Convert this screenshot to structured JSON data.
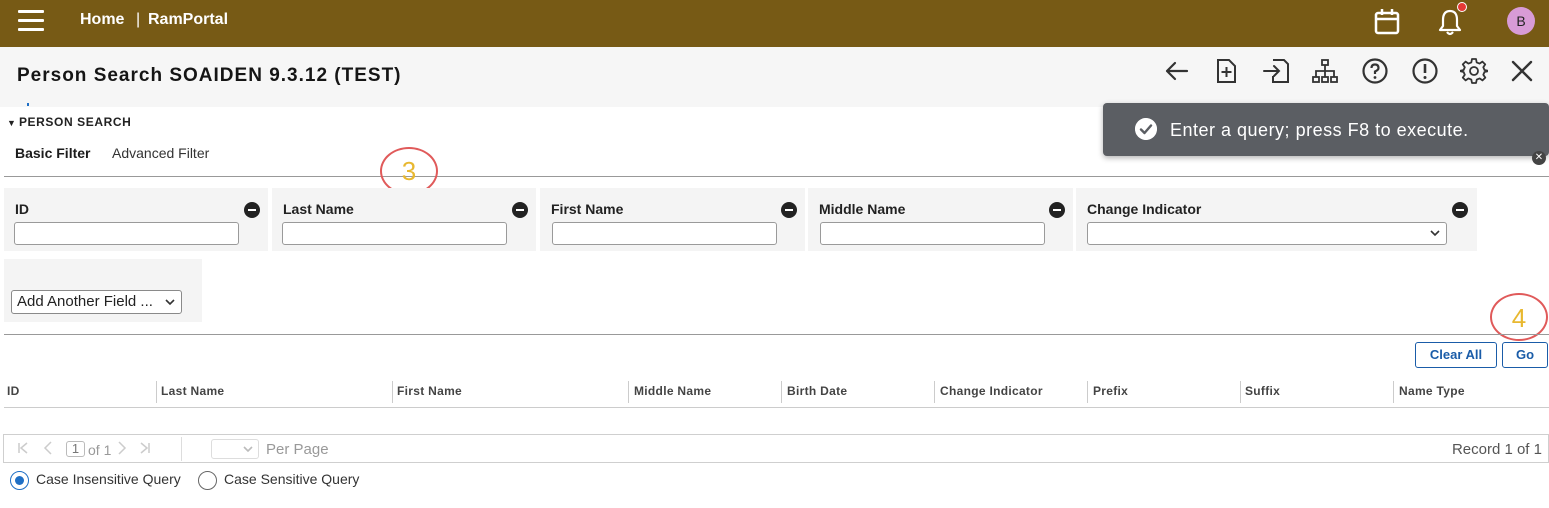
{
  "topbar": {
    "home_label": "Home",
    "separator": "|",
    "portal_label": "RamPortal",
    "avatar_initial": "B",
    "notification_dot": true
  },
  "title": {
    "text": "Person Search SOAIDEN 9.3.12 (TEST)"
  },
  "toolbar": {
    "icons": [
      "back-arrow-icon",
      "new-document-icon",
      "export-icon",
      "hierarchy-icon",
      "help-icon",
      "alert-icon",
      "settings-icon",
      "close-icon"
    ]
  },
  "toast": {
    "message": "Enter a query; press F8 to execute."
  },
  "section": {
    "title": "PERSON SEARCH",
    "tabs": [
      {
        "label": "Basic Filter",
        "active": true
      },
      {
        "label": "Advanced Filter",
        "active": false
      }
    ]
  },
  "annotations": {
    "step3": "3",
    "step4": "4"
  },
  "filters": [
    {
      "label": "ID",
      "value": "",
      "type": "text"
    },
    {
      "label": "Last Name",
      "value": "",
      "type": "text"
    },
    {
      "label": "First Name",
      "value": "",
      "type": "text"
    },
    {
      "label": "Middle Name",
      "value": "",
      "type": "text"
    },
    {
      "label": "Change Indicator",
      "value": "",
      "type": "select"
    }
  ],
  "add_field": {
    "label": "Add Another Field ..."
  },
  "buttons": {
    "clear_all": "Clear All",
    "go": "Go"
  },
  "table": {
    "columns": [
      "ID",
      "Last Name",
      "First Name",
      "Middle Name",
      "Birth Date",
      "Change Indicator",
      "Prefix",
      "Suffix",
      "Name Type"
    ],
    "rows": []
  },
  "pager": {
    "current_page": "1",
    "of_pages": "of 1",
    "per_page_label": "Per Page",
    "record_text": "Record 1 of 1"
  },
  "query_options": [
    {
      "label": "Case Insensitive Query",
      "selected": true
    },
    {
      "label": "Case Sensitive Query",
      "selected": false
    }
  ],
  "colors": {
    "topbar": "#775a15",
    "primary_blue": "#1a5ca8",
    "toast_bg": "#5b5e63"
  }
}
